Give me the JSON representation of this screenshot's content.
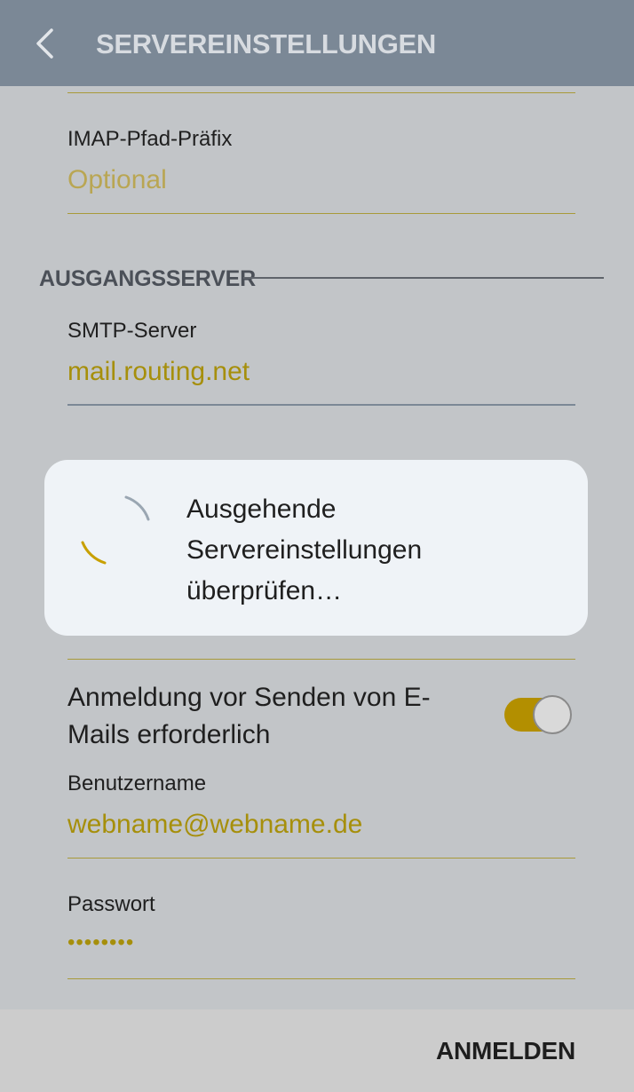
{
  "appbar": {
    "title": "SERVEREINSTELLUNGEN",
    "back_icon": "chevron-left-icon"
  },
  "incoming": {
    "imap_prefix": {
      "label": "IMAP-Pfad-Präfix",
      "placeholder": "Optional"
    }
  },
  "outgoing": {
    "section_title": "AUSGANGSSERVER",
    "smtp_server": {
      "label": "SMTP-Server",
      "value": "mail.routing.net"
    },
    "require_login": {
      "label": "Anmeldung vor Senden von E-Mails erforderlich",
      "enabled": true
    },
    "username": {
      "label": "Benutzername",
      "value": "webname@webname.de"
    },
    "password": {
      "label": "Passwort",
      "value": "••••••••"
    }
  },
  "dialog": {
    "message_line1": "Ausgehende",
    "message_line2": "Servereinstellungen",
    "message_line3": "überprüfen…",
    "spinner_icon": "loading-spinner-icon"
  },
  "footer": {
    "login_label": "ANMELDEN"
  },
  "colors": {
    "appbar": "#7b8896",
    "accent": "#a68f0b",
    "background": "#c2c5c8",
    "dialog": "#eff3f7"
  }
}
